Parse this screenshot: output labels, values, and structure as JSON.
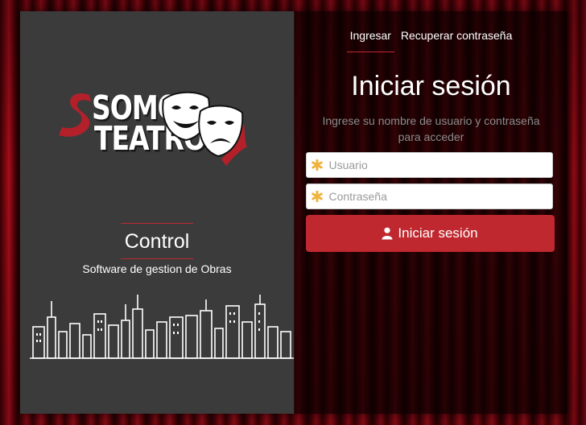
{
  "brand": {
    "logo_line1": "SOMOS",
    "logo_line2": "TEATRO",
    "product": "Control",
    "tagline": "Software de gestion de Obras",
    "accent_color": "#c0282f"
  },
  "tabs": [
    {
      "label": "Ingresar",
      "active": true
    },
    {
      "label": "Recuperar contraseña",
      "active": false
    }
  ],
  "login": {
    "title": "Iniciar sesión",
    "hint": "Ingrese su nombre de usuario y contraseña para acceder",
    "username_placeholder": "Usuario",
    "password_placeholder": "Contraseña",
    "submit_label": "Iniciar sesión",
    "field_icon": "asterisk-icon",
    "submit_icon": "user-icon"
  }
}
